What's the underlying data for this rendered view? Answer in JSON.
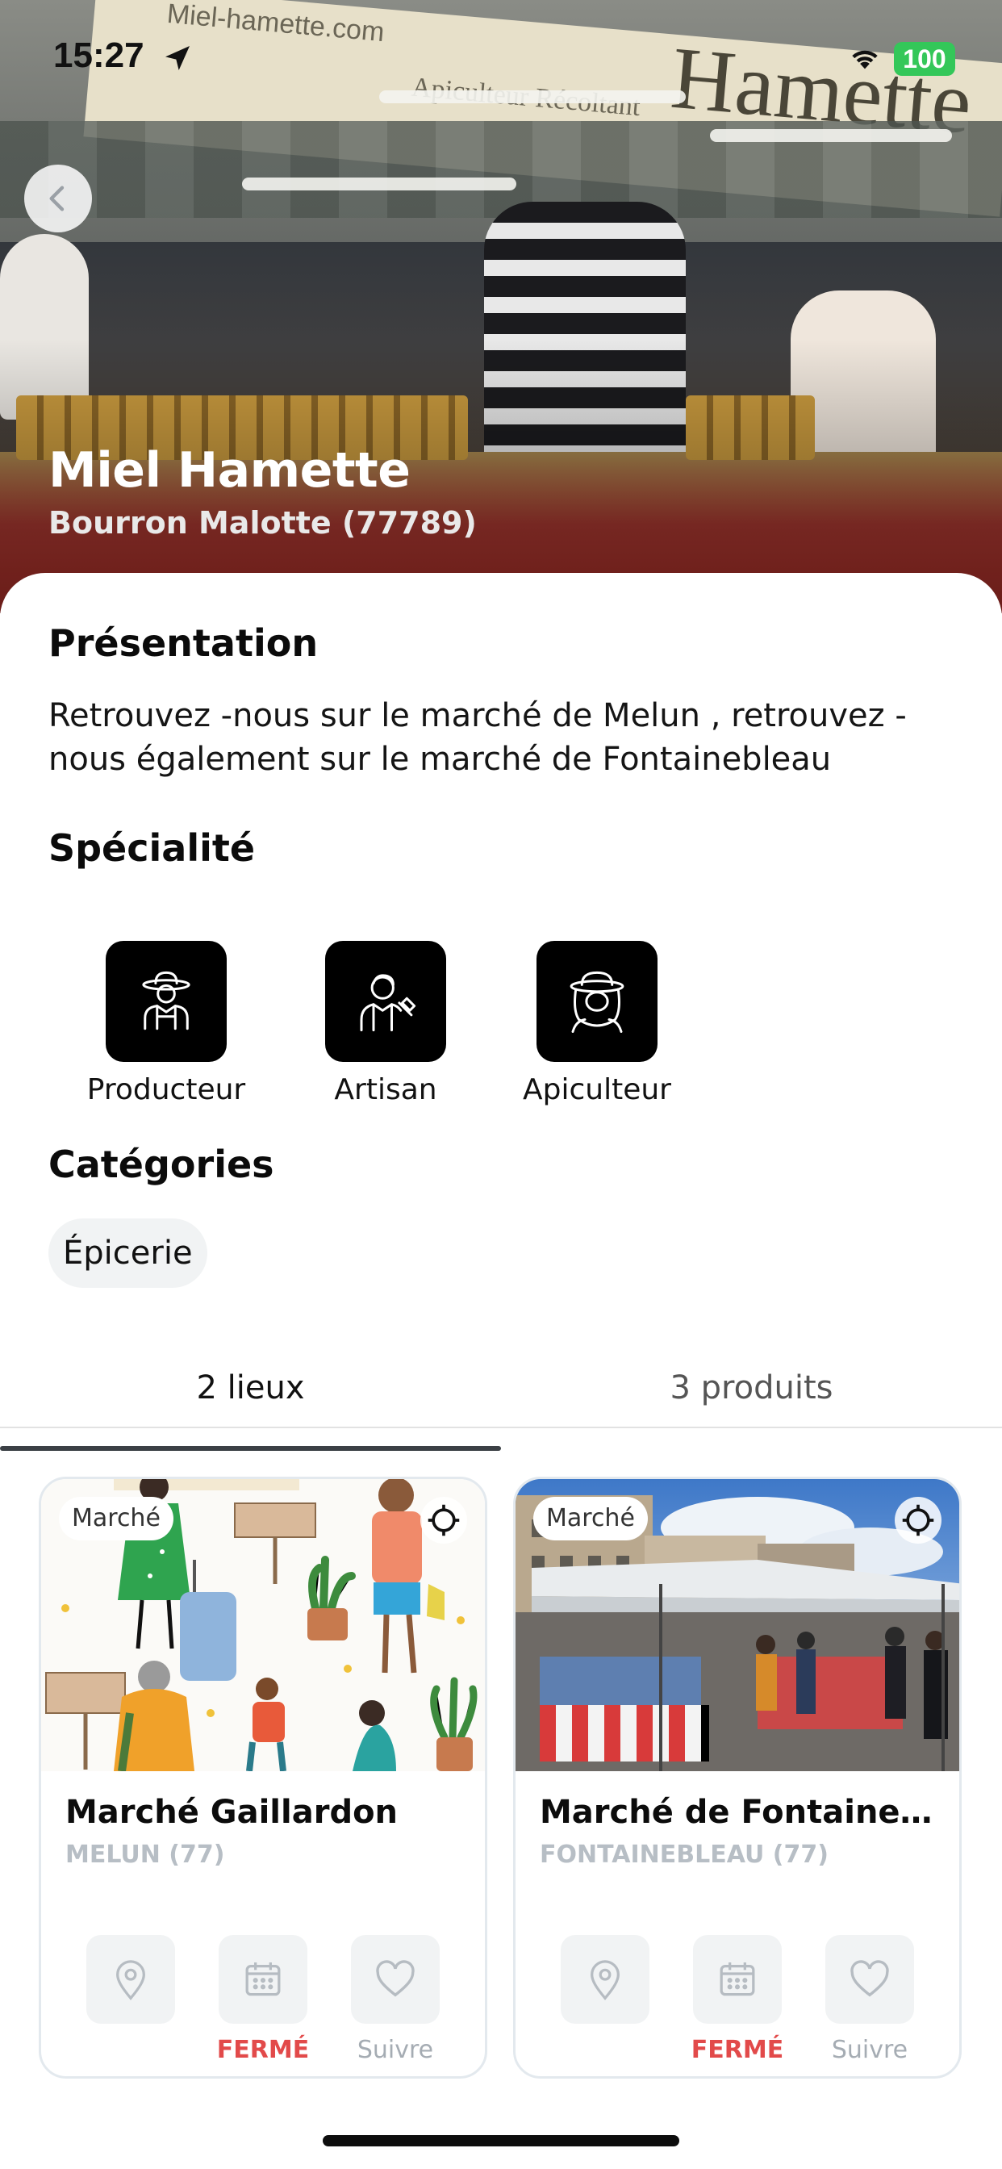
{
  "status_bar": {
    "time": "15:27",
    "battery": "100"
  },
  "hero": {
    "title": "Miel Hamette",
    "subtitle": "Bourron Malotte (77789)",
    "banner_site": "Miel-hamette.com",
    "banner_sub": "Apiculteur Récoltant",
    "banner_brand": "Hamette"
  },
  "presentation": {
    "title": "Présentation",
    "text": "Retrouvez -nous sur le marché de Melun , retrouvez -nous également sur le marché de Fontainebleau"
  },
  "specialite": {
    "title": "Spécialité",
    "items": [
      {
        "label": "Producteur",
        "icon": "farmer-icon"
      },
      {
        "label": "Artisan",
        "icon": "artisan-icon"
      },
      {
        "label": "Apiculteur",
        "icon": "beekeeper-icon"
      }
    ]
  },
  "categories": {
    "title": "Catégories",
    "chips": [
      "Épicerie"
    ]
  },
  "tabs": [
    {
      "label": "2 lieux",
      "active": true
    },
    {
      "label": "3 produits",
      "active": false
    }
  ],
  "cards": [
    {
      "badge": "Marché",
      "title": "Marché Gaillardon",
      "city": "MELUN (77)",
      "actions": {
        "location_label": "",
        "schedule_label": "FERMÉ",
        "follow_label": "Suivre"
      }
    },
    {
      "badge": "Marché",
      "title": "Marché de Fontaineb...",
      "city": "FONTAINEBLEAU (77)",
      "actions": {
        "location_label": "",
        "schedule_label": "FERMÉ",
        "follow_label": "Suivre"
      }
    }
  ],
  "colors": {
    "closed": "#e24a4a",
    "muted": "#a5acb3",
    "city": "#b7bec5",
    "battery": "#34c759",
    "icon_tile": "#000000"
  }
}
